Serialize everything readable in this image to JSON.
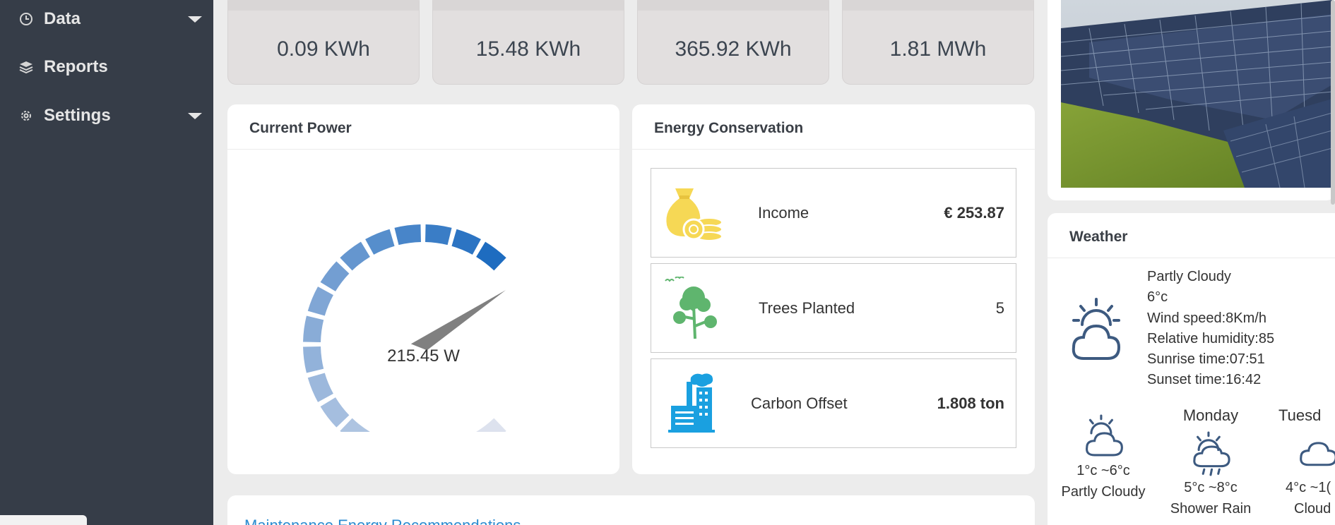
{
  "sidebar": {
    "items": [
      {
        "label": "Data",
        "icon": "clock-icon",
        "has_submenu": true
      },
      {
        "label": "Reports",
        "icon": "layers-icon",
        "has_submenu": false
      },
      {
        "label": "Settings",
        "icon": "gear-icon",
        "has_submenu": true
      }
    ]
  },
  "stats": [
    {
      "value": "0.09 KWh"
    },
    {
      "value": "15.48 KWh"
    },
    {
      "value": "365.92 KWh"
    },
    {
      "value": "1.81 MWh"
    }
  ],
  "current_power": {
    "title": "Current Power",
    "value_label": "215.45 W",
    "gauge_fraction": 0.71
  },
  "energy_conservation": {
    "title": "Energy Conservation",
    "items": [
      {
        "label": "Income",
        "value": "€ 253.87",
        "icon": "money-bag-coins-icon",
        "bold_value": true
      },
      {
        "label": "Trees Planted",
        "value": "5",
        "icon": "trees-icon",
        "bold_value": false
      },
      {
        "label": "Carbon Offset",
        "value": "1.808 ton",
        "icon": "factory-icon",
        "bold_value": true
      }
    ]
  },
  "weather": {
    "title": "Weather",
    "current": {
      "condition": "Partly Cloudy",
      "temp": "6°c",
      "wind": "Wind speed:8Km/h",
      "humidity": "Relative humidity:85",
      "sunrise": "Sunrise time:07:51",
      "sunset": "Sunset time:16:42"
    },
    "forecast": [
      {
        "day": "",
        "range": "1°c ~6°c",
        "condition": "Partly Cloudy",
        "icon": "partly-cloudy-icon"
      },
      {
        "day": "Monday",
        "range": "5°c ~8°c",
        "condition": "Shower Rain",
        "icon": "shower-rain-icon"
      },
      {
        "day": "Tuesd",
        "range": "4°c ~1(",
        "condition": "Cloud",
        "icon": "cloudy-icon"
      }
    ]
  },
  "bottom": {
    "link_text": "Maintenance Energy Recommendations"
  },
  "colors": {
    "sidebar_bg": "#363d48",
    "gauge_dark": "#1e6cc0",
    "gauge_light": "#dde2ee",
    "link": "#2a8bd0",
    "icon_yellow": "#f6d855",
    "icon_green": "#5fb56e",
    "icon_blue": "#1aa0e0",
    "weather_icon": "#3d5a80"
  }
}
